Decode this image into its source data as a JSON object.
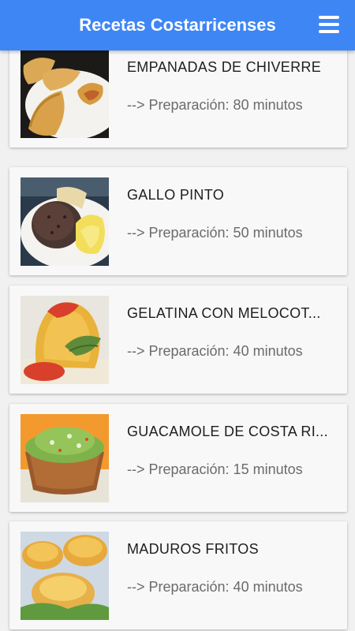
{
  "app": {
    "title": "Recetas Costarricenses",
    "icon": "hamburger-menu-icon",
    "accent_color": "#3f86f5"
  },
  "recipes": [
    {
      "name": "EMPANADAS DE CHIVERRE",
      "time": "--> Preparación: 80 minutos"
    },
    {
      "name": "GALLO PINTO",
      "time": "--> Preparación: 50 minutos"
    },
    {
      "name": "GELATINA CON MELOCOT...",
      "time": "--> Preparación: 40 minutos"
    },
    {
      "name": "GUACAMOLE DE COSTA RI...",
      "time": "--> Preparación: 15 minutos"
    },
    {
      "name": "MADUROS FRITOS",
      "time": "--> Preparación: 40 minutos"
    }
  ]
}
